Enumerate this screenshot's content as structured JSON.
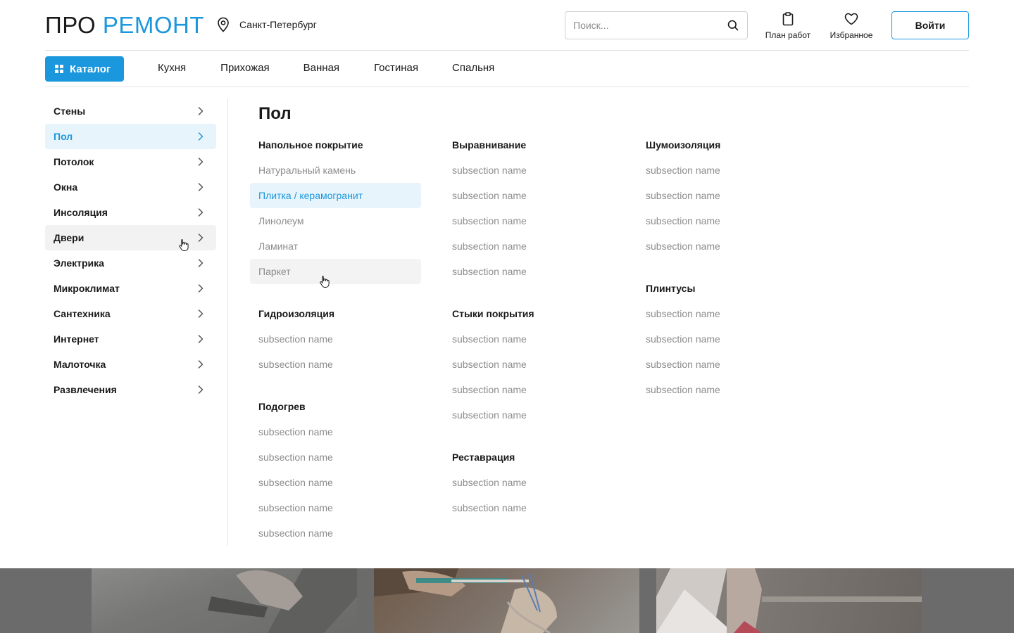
{
  "header": {
    "logo_part1": "ПРО",
    "logo_part2": "РЕМОНТ",
    "city": "Санкт-Петербург",
    "search_placeholder": "Поиск...",
    "plan_label": "План работ",
    "favorites_label": "Избранное",
    "login_label": "Войти"
  },
  "nav": {
    "catalog_label": "Каталог",
    "links": [
      "Кухня",
      "Прихожая",
      "Ванная",
      "Гостиная",
      "Спальня"
    ]
  },
  "sidebar": {
    "items": [
      "Стены",
      "Пол",
      "Потолок",
      "Окна",
      "Инсоляция",
      "Двери",
      "Электрика",
      "Микроклимат",
      "Сантехника",
      "Интернет",
      "Малоточка",
      "Развлечения"
    ],
    "active_item": "Пол",
    "hovered_item": "Двери"
  },
  "content": {
    "title": "Пол",
    "columns": [
      [
        {
          "heading": "Напольное покрытие",
          "items": [
            "Натуральный камень",
            "Плитка / керамогранит",
            "Линолеум",
            "Ламинат",
            "Паркет"
          ]
        },
        {
          "heading": "Гидроизоляция",
          "items": [
            "subsection name",
            "subsection name"
          ]
        },
        {
          "heading": "Подогрев",
          "items": [
            "subsection name",
            "subsection name",
            "subsection name",
            "subsection name",
            "subsection name"
          ]
        }
      ],
      [
        {
          "heading": "Выравнивание",
          "items": [
            "subsection name",
            "subsection name",
            "subsection name",
            "subsection name",
            "subsection name"
          ]
        },
        {
          "heading": "Стыки покрытия",
          "items": [
            "subsection name",
            "subsection name",
            "subsection name",
            "subsection name"
          ]
        },
        {
          "heading": "Реставрация",
          "items": [
            "subsection name",
            "subsection name"
          ]
        }
      ],
      [
        {
          "heading": "Шумоизоляция",
          "items": [
            "subsection name",
            "subsection name",
            "subsection name",
            "subsection name"
          ]
        },
        {
          "heading": "Плинтусы",
          "items": [
            "subsection name",
            "subsection name",
            "subsection name",
            "subsection name"
          ]
        }
      ]
    ],
    "selected_item": "Плитка / керамогранит",
    "hovered_item": "Паркет"
  },
  "colors": {
    "accent": "#1a97dd",
    "active_bg": "#e7f4fc",
    "hover_bg": "#f2f2f2",
    "muted_text": "#8c8c8c"
  }
}
